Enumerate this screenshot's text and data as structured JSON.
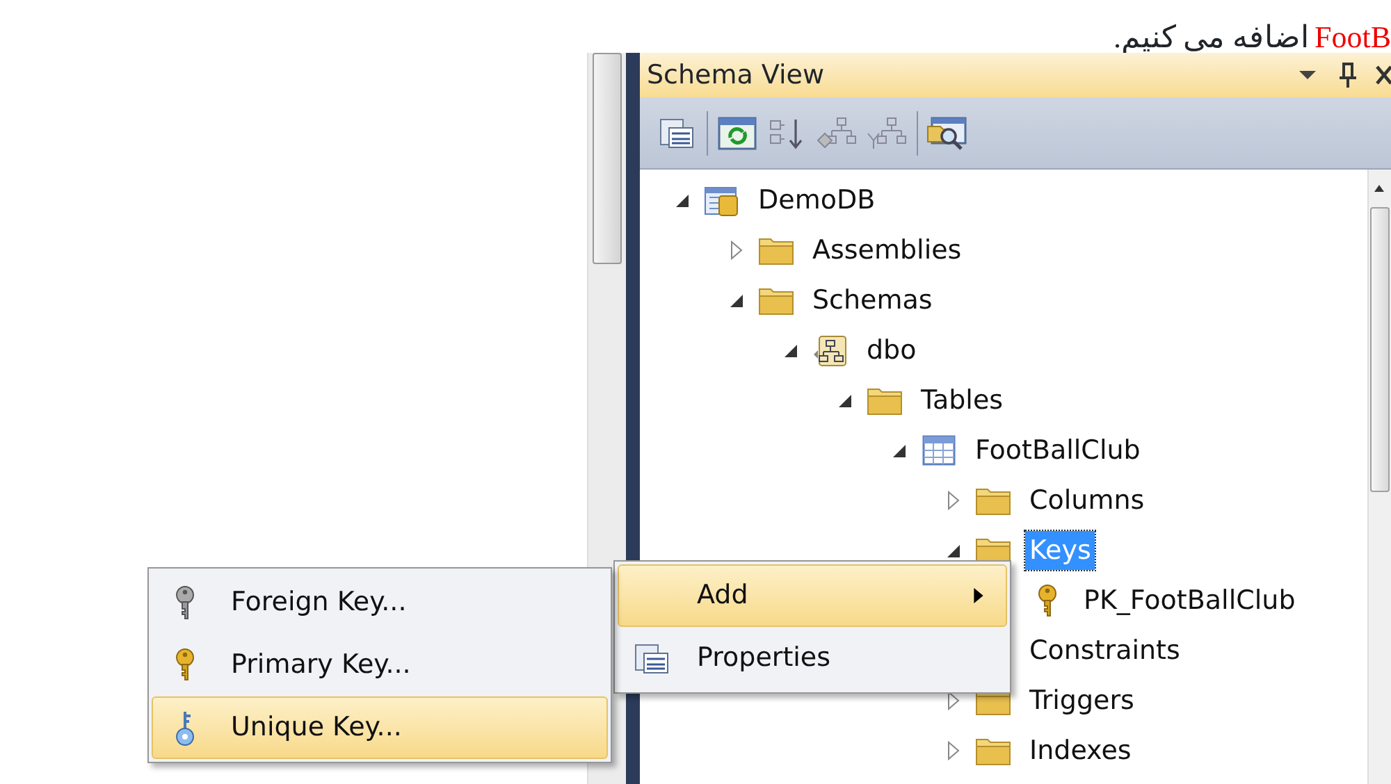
{
  "caption": {
    "highlight": "FootB",
    "text": "اضافه می کنیم."
  },
  "panel": {
    "title": "Schema View"
  },
  "toolbar": [
    {
      "kind": "properties"
    },
    {
      "kind": "separator"
    },
    {
      "kind": "refresh"
    },
    {
      "kind": "sort"
    },
    {
      "kind": "hierarchy-a"
    },
    {
      "kind": "hierarchy-b"
    },
    {
      "kind": "separator"
    },
    {
      "kind": "find"
    }
  ],
  "tree": [
    {
      "label": "DemoDB",
      "kind": "database",
      "expanded": true,
      "selected": false,
      "children": [
        {
          "label": "Assemblies",
          "kind": "folder",
          "expanded": false,
          "selected": false
        },
        {
          "label": "Schemas",
          "kind": "folder",
          "expanded": true,
          "selected": false,
          "children": [
            {
              "label": "dbo",
              "kind": "schema",
              "expanded": true,
              "selected": false,
              "children": [
                {
                  "label": "Tables",
                  "kind": "folder",
                  "expanded": true,
                  "selected": false,
                  "children": [
                    {
                      "label": "FootBallClub",
                      "kind": "table",
                      "expanded": true,
                      "selected": false,
                      "children": [
                        {
                          "label": "Columns",
                          "kind": "folder",
                          "expanded": false,
                          "selected": false
                        },
                        {
                          "label": "Keys",
                          "kind": "folder",
                          "expanded": true,
                          "selected": true,
                          "children": [
                            {
                              "label": "PK_FootBallClub",
                              "kind": "key",
                              "selected": false
                            }
                          ]
                        },
                        {
                          "label": "Constraints",
                          "selected": false
                        },
                        {
                          "label": "Triggers",
                          "kind": "folder",
                          "expanded": false,
                          "selected": false
                        },
                        {
                          "label": "Indexes",
                          "kind": "folder",
                          "expanded": false,
                          "selected": false
                        }
                      ]
                    }
                  ]
                }
              ]
            }
          ]
        }
      ]
    }
  ],
  "context_menu": [
    {
      "label": "Add",
      "submenu": true,
      "selected": true
    },
    {
      "label": "Properties",
      "kind": "properties",
      "submenu": false,
      "selected": false
    }
  ],
  "submenu": [
    {
      "label": "Foreign Key...",
      "kind": "foreign",
      "selected": false
    },
    {
      "label": "Primary Key...",
      "kind": "primary",
      "selected": false
    },
    {
      "label": "Unique Key...",
      "kind": "unique",
      "selected": true
    }
  ]
}
